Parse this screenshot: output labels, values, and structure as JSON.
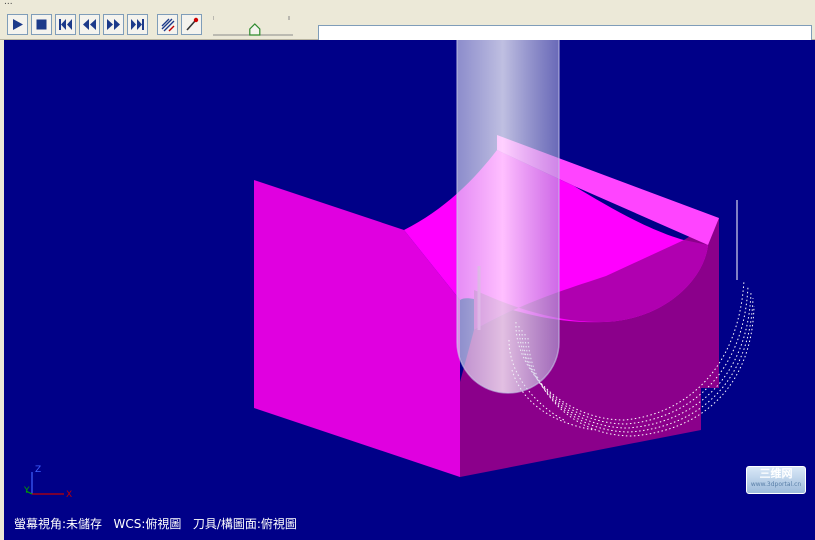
{
  "window": {
    "title": "..."
  },
  "toolbar": {
    "buttons": [
      {
        "name": "play-button",
        "icon": "play-icon"
      },
      {
        "name": "stop-button",
        "icon": "stop-icon"
      },
      {
        "name": "first-step-button",
        "icon": "skip-start-icon"
      },
      {
        "name": "step-back-button",
        "icon": "step-back-icon"
      },
      {
        "name": "step-forward-button",
        "icon": "step-forward-icon"
      },
      {
        "name": "last-step-button",
        "icon": "skip-end-icon"
      },
      {
        "name": "path-display-button",
        "icon": "toolpath-icon"
      },
      {
        "name": "tool-display-button",
        "icon": "tool-icon"
      }
    ],
    "speed_level": 0.55,
    "progress_fraction": 1.0
  },
  "viewport": {
    "status_text": "螢幕視角:未儲存   WCS:俯視圖   刀具/構圖面:俯視圖",
    "axis_labels": {
      "z": "Z",
      "y": "Y",
      "x": "X"
    },
    "background_color": "#000088",
    "part_color": "#e000e0"
  },
  "watermark": {
    "title": "三维网",
    "subtitle": "www.3dportal.cn"
  }
}
